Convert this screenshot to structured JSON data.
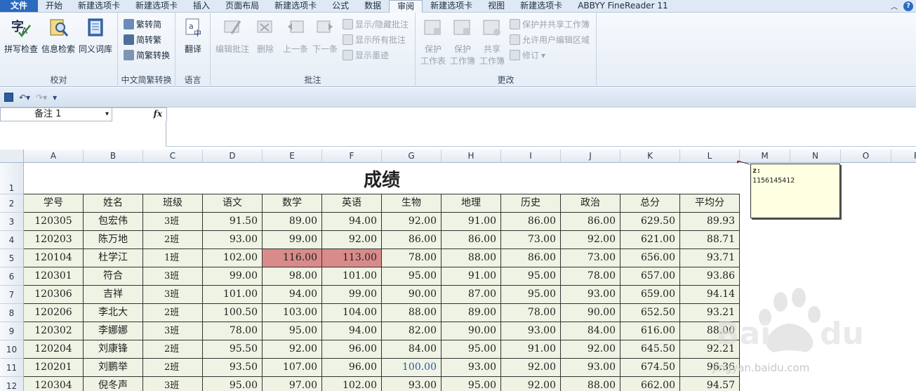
{
  "tabs": [
    {
      "label": "文件",
      "kind": "file"
    },
    {
      "label": "开始"
    },
    {
      "label": "新建选项卡"
    },
    {
      "label": "新建选项卡"
    },
    {
      "label": "插入"
    },
    {
      "label": "页面布局"
    },
    {
      "label": "新建选项卡"
    },
    {
      "label": "公式"
    },
    {
      "label": "数据"
    },
    {
      "label": "审阅",
      "active": true
    },
    {
      "label": "新建选项卡"
    },
    {
      "label": "视图"
    },
    {
      "label": "新建选项卡"
    },
    {
      "label": "ABBYY FineReader 11"
    }
  ],
  "ribbon": {
    "proofing": {
      "label": "校对",
      "spell": "拼写检查",
      "research": "信息检索",
      "thesaurus": "同义词库"
    },
    "chinese": {
      "label": "中文简繁转换",
      "to_simple": "繁转简",
      "to_trad": "简转繁",
      "convert": "简繁转换"
    },
    "language": {
      "label": "语言",
      "translate": "翻译"
    },
    "comments": {
      "label": "批注",
      "edit": "编辑批注",
      "delete": "删除",
      "prev": "上一条",
      "next": "下一条",
      "show_hide": "显示/隐藏批注",
      "show_all": "显示所有批注",
      "show_ink": "显示墨迹"
    },
    "changes": {
      "label": "更改",
      "protect_sheet_1": "保护",
      "protect_sheet_2": "工作表",
      "protect_wb_1": "保护",
      "protect_wb_2": "工作簿",
      "share_wb_1": "共享",
      "share_wb_2": "工作簿",
      "protect_share": "保护并共享工作簿",
      "allow_edit": "允许用户编辑区域",
      "track": "修订"
    }
  },
  "namebox": {
    "value": "备注 1"
  },
  "fx_label": "fx",
  "columns": [
    "A",
    "B",
    "C",
    "D",
    "E",
    "F",
    "G",
    "H",
    "I",
    "J",
    "K",
    "L",
    "M",
    "N",
    "O",
    "P"
  ],
  "rows": [
    "1",
    "2",
    "3",
    "4",
    "5",
    "6",
    "7",
    "8",
    "9",
    "10",
    "11",
    "12"
  ],
  "sheet_title": "成绩",
  "headers": [
    "学号",
    "姓名",
    "班级",
    "语文",
    "数学",
    "英语",
    "生物",
    "地理",
    "历史",
    "政治",
    "总分",
    "平均分"
  ],
  "records": [
    [
      "120305",
      "包宏伟",
      "3班",
      "91.50",
      "89.00",
      "94.00",
      "92.00",
      "91.00",
      "86.00",
      "86.00",
      "629.50",
      "89.93"
    ],
    [
      "120203",
      "陈万地",
      "2班",
      "93.00",
      "99.00",
      "92.00",
      "86.00",
      "86.00",
      "73.00",
      "92.00",
      "621.00",
      "88.71"
    ],
    [
      "120104",
      "杜学江",
      "1班",
      "102.00",
      "116.00",
      "113.00",
      "78.00",
      "88.00",
      "86.00",
      "73.00",
      "656.00",
      "93.71"
    ],
    [
      "120301",
      "符合",
      "3班",
      "99.00",
      "98.00",
      "101.00",
      "95.00",
      "91.00",
      "95.00",
      "78.00",
      "657.00",
      "93.86"
    ],
    [
      "120306",
      "吉祥",
      "3班",
      "101.00",
      "94.00",
      "99.00",
      "90.00",
      "87.00",
      "95.00",
      "93.00",
      "659.00",
      "94.14"
    ],
    [
      "120206",
      "李北大",
      "2班",
      "100.50",
      "103.00",
      "104.00",
      "88.00",
      "89.00",
      "78.00",
      "90.00",
      "652.50",
      "93.21"
    ],
    [
      "120302",
      "李娜娜",
      "3班",
      "78.00",
      "95.00",
      "94.00",
      "82.00",
      "90.00",
      "93.00",
      "84.00",
      "616.00",
      "88.00"
    ],
    [
      "120204",
      "刘康锋",
      "2班",
      "95.50",
      "92.00",
      "96.00",
      "84.00",
      "95.00",
      "91.00",
      "92.00",
      "645.50",
      "92.21"
    ],
    [
      "120201",
      "刘鹏举",
      "2班",
      "93.50",
      "107.00",
      "96.00",
      "100.00",
      "93.00",
      "92.00",
      "93.00",
      "674.50",
      "96.36"
    ],
    [
      "120304",
      "倪冬声",
      "3班",
      "95.00",
      "97.00",
      "102.00",
      "93.00",
      "95.00",
      "92.00",
      "88.00",
      "662.00",
      "94.57"
    ]
  ],
  "comment": {
    "author": "z:",
    "text": "1156145412"
  },
  "watermark": {
    "text": "jingyan.baidu.com"
  },
  "colors": {
    "highlight": "#d98b8b",
    "table_bg": "#eef3e4",
    "comment_bg": "#ffffe1",
    "file_tab": "#2a6abf"
  }
}
